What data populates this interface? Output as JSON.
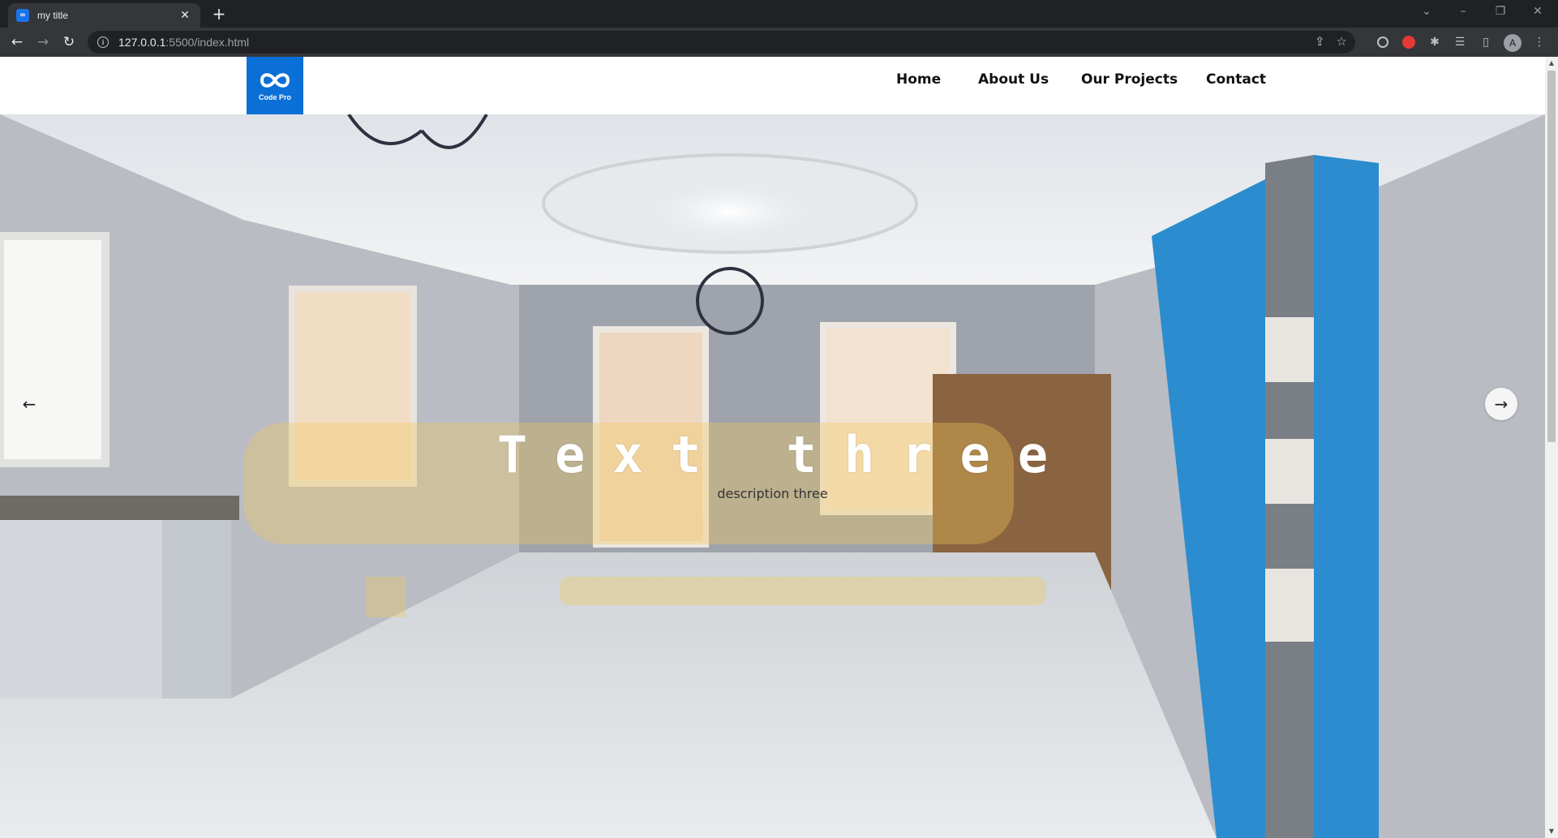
{
  "browser": {
    "tab_title": "my title",
    "url_host": "127.0.0.1",
    "url_rest": ":5500/index.html",
    "profile_initial": "A"
  },
  "site": {
    "logo_text": "Code Pro",
    "nav": [
      "Home",
      "About Us",
      "Our Projects",
      "Contact"
    ]
  },
  "hero": {
    "title": "Text three",
    "description": "description three"
  },
  "colors": {
    "brand_blue": "#0a6fd6",
    "accent_wall_blue": "#2a8fd0"
  }
}
